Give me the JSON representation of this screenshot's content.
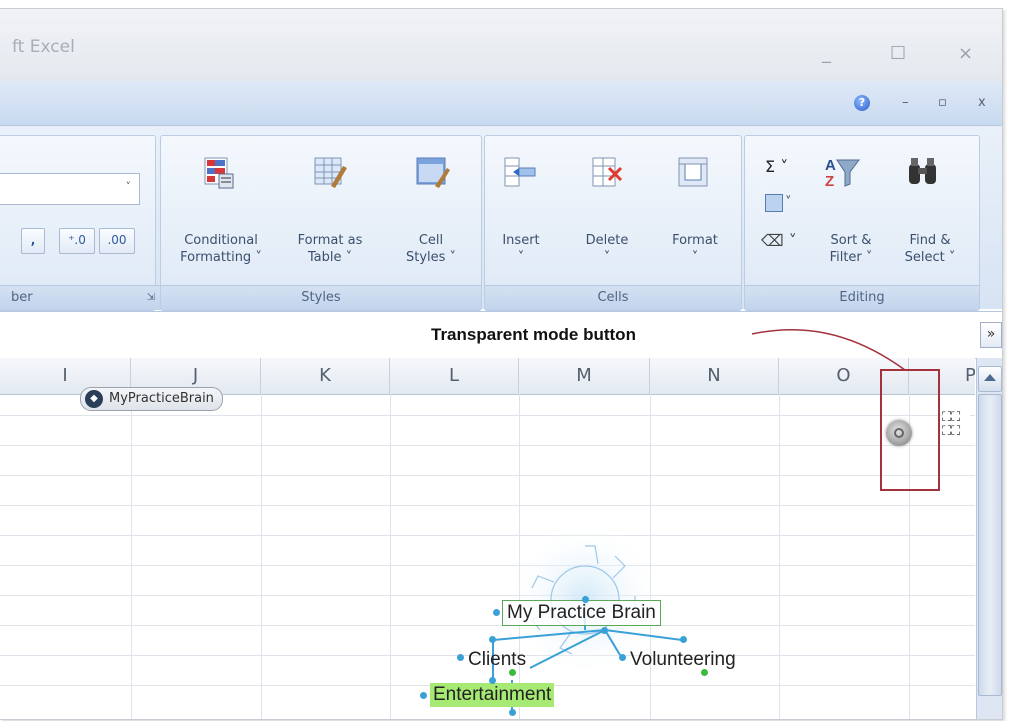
{
  "window": {
    "title": "ft Excel",
    "controls": {
      "minimize": "_",
      "maximize": "☐",
      "close": "×"
    }
  },
  "menu": {
    "help": "?",
    "doc_minimize": "–",
    "doc_restore": "▫",
    "doc_close": "x"
  },
  "ribbon": {
    "number": {
      "label": "ber",
      "comma": ",",
      "increase_decimal": "⁺.0",
      "decrease_decimal": ".00"
    },
    "styles": {
      "label": "Styles",
      "conditional_formatting": [
        "Conditional",
        "Formatting ˅"
      ],
      "format_as_table": [
        "Format as",
        "Table ˅"
      ],
      "cell_styles": [
        "Cell",
        "Styles ˅"
      ]
    },
    "cells": {
      "label": "Cells",
      "insert": [
        "Insert",
        "˅"
      ],
      "delete": [
        "Delete",
        "˅"
      ],
      "format": [
        "Format",
        "˅"
      ]
    },
    "editing": {
      "label": "Editing",
      "sigma": "Σ ˅",
      "fill": "˅",
      "clear": "˅",
      "sort_filter": [
        "Sort &",
        "Filter ˅"
      ],
      "find_select": [
        "Find &",
        "Select ˅"
      ]
    }
  },
  "annotation": {
    "text": "Transparent mode button",
    "color": "#a3323e"
  },
  "formula_bar": {
    "expand": "»"
  },
  "columns": [
    "I",
    "J",
    "K",
    "L",
    "M",
    "N",
    "O",
    "P"
  ],
  "brain": {
    "tab_label": "MyPracticeBrain",
    "nodes": {
      "central": "My Practice Brain",
      "clients": "Clients",
      "volunteering": "Volunteering",
      "entertainment": "Entertainment"
    },
    "colors": {
      "link": "#3aa0d8",
      "active": "#a6ea73",
      "border": "#58a858"
    }
  }
}
